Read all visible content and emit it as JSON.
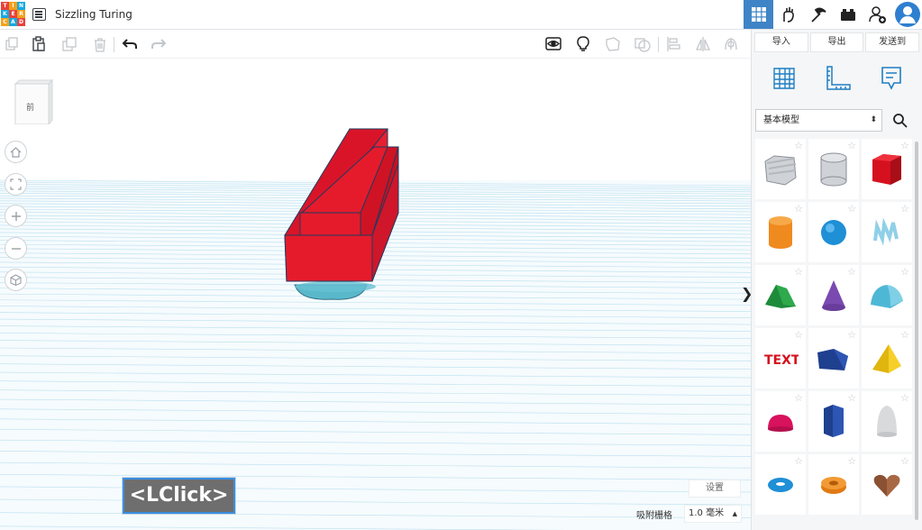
{
  "header": {
    "logo_letters": [
      "T",
      "I",
      "N",
      "K",
      "E",
      "R",
      "C",
      "A",
      "D"
    ],
    "logo_colors": [
      "#e8423c",
      "#f2a21b",
      "#16a9e0",
      "#16a9e0",
      "#e8423c",
      "#f2a21b",
      "#f2a21b",
      "#16a9e0",
      "#e8423c"
    ],
    "title": "Sizzling Turing",
    "icons": [
      "3d-design-icon",
      "circuits-icon",
      "codeblocks-icon",
      "lego-bricks-icon",
      "add-user-icon",
      "avatar"
    ]
  },
  "toolbar": {
    "left_tools": [
      "copy-icon",
      "paste-icon",
      "duplicate-icon",
      "delete-icon",
      "undo-icon",
      "redo-icon"
    ],
    "right_tools": [
      "show-all-icon",
      "lightbulb-icon",
      "group-icon",
      "ungroup-icon",
      "align-icon",
      "mirror-icon",
      "cruise-icon"
    ]
  },
  "panel": {
    "tabs": [
      "导入",
      "导出",
      "发送到"
    ],
    "view_icons": [
      "workplane-grid-icon",
      "ruler-icon",
      "notes-icon"
    ],
    "library_select": "基本模型",
    "shapes": [
      "box-hole",
      "cylinder-hole",
      "box",
      "cylinder",
      "sphere",
      "scribble",
      "roof",
      "cone",
      "round-roof",
      "text",
      "wedge",
      "pyramid",
      "half-sphere",
      "polygon",
      "paraboloid",
      "torus",
      "tube",
      "heart"
    ]
  },
  "viewport": {
    "nav_cube_label": "前",
    "nav_buttons": [
      "home-icon",
      "fit-icon",
      "zoom-in-icon",
      "zoom-out-icon",
      "perspective-icon"
    ],
    "settings_label": "设置",
    "snap_label": "吸附栅格",
    "snap_value": "1.0 毫米",
    "collapse_arrow": "❯"
  },
  "overlay": {
    "click_label": "<LClick>"
  },
  "colors": {
    "accent": "#3f84c6",
    "red": "#e51b2c",
    "grid_line": "#9fd4ea"
  }
}
